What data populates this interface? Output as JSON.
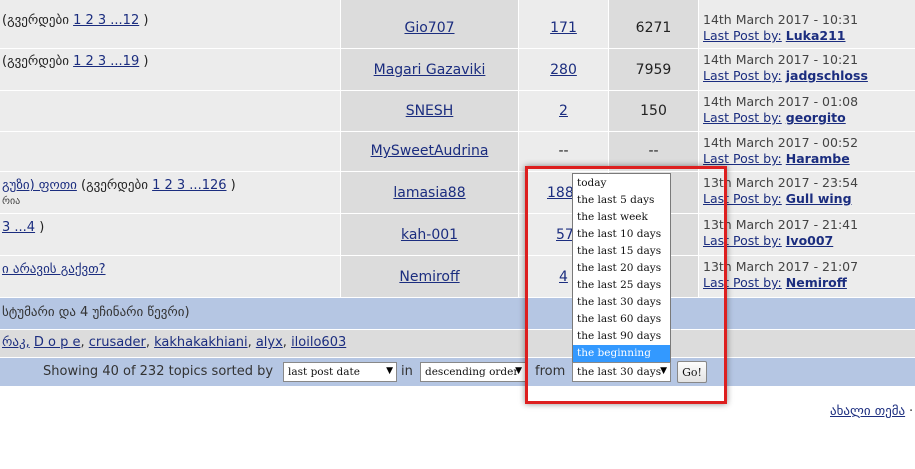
{
  "topics": [
    {
      "title_text": "(გვერდები",
      "pages": "1 2 3 ...12",
      "tail": ")",
      "subtitle": "",
      "author": "Gio707",
      "replies": "171",
      "views": "6271",
      "last_date": "14th March 2017 - 10:31",
      "last_by_label": "Last Post by:",
      "last_user": "Luka211"
    },
    {
      "title_text": "(გვერდები",
      "pages": "1 2 3 ...19",
      "tail": ")",
      "subtitle": "",
      "author": "Magari Gazaviki",
      "replies": "280",
      "views": "7959",
      "last_date": "14th March 2017 - 10:21",
      "last_by_label": "Last Post by:",
      "last_user": "jadgschloss"
    },
    {
      "title_text": "",
      "pages": "",
      "tail": "",
      "subtitle": "",
      "author": "SNESH",
      "replies": "2",
      "views": "150",
      "last_date": "14th March 2017 - 01:08",
      "last_by_label": "Last Post by:",
      "last_user": "georgito"
    },
    {
      "title_text": "",
      "pages": "",
      "tail": "",
      "subtitle": "",
      "author": "MySweetAudrina",
      "replies": "--",
      "views": "--",
      "last_date": "14th March 2017 - 00:52",
      "last_by_label": "Last Post by:",
      "last_user": "Harambe"
    },
    {
      "title_link": "გუზი) ფოთი",
      "title_text": "(გვერდები",
      "pages": "1 2 3 ...126",
      "tail": ")",
      "subtitle": "რია",
      "author": "lamasia88",
      "replies": "188",
      "views": "",
      "last_date": "13th March 2017 - 23:54",
      "last_by_label": "Last Post by:",
      "last_user": "Gull wing"
    },
    {
      "title_link": "3 ...4",
      "title_text": "",
      "pages": "",
      "tail": ")",
      "subtitle": "",
      "author": "kah-001",
      "replies": "57",
      "views": "",
      "last_date": "13th March 2017 - 21:41",
      "last_by_label": "Last Post by:",
      "last_user": "Ivo007"
    },
    {
      "title_link": "ი არავის გაქვთ?",
      "title_text": "",
      "pages": "",
      "tail": "",
      "subtitle": "",
      "author": "Nemiroff",
      "replies": "4",
      "views": "",
      "last_date": "13th March 2017 - 21:07",
      "last_by_label": "Last Post by:",
      "last_user": "Nemiroff"
    }
  ],
  "stats": {
    "guests_text": "სტუმარი და 4 უჩინარი წევრი)",
    "users_prefix": "რაკ,",
    "users": [
      "D o p e",
      "crusader",
      "kakhakakhiani",
      "alyx",
      "iloilo603"
    ]
  },
  "sort_bar": {
    "showing_text": "Showing 40 of 232 topics sorted by",
    "sort_by_value": "last post date",
    "in_label": "in",
    "order_value": "descending order",
    "from_label": "from",
    "from_value": "the last 30 days",
    "go_label": "Go!"
  },
  "dropdown": {
    "options": [
      "today",
      "the last 5 days",
      "the last week",
      "the last 10 days",
      "the last 15 days",
      "the last 20 days",
      "the last 25 days",
      "the last 30 days",
      "the last 60 days",
      "the last 90 days",
      "the beginning"
    ],
    "highlighted": "the beginning"
  },
  "footer": {
    "new_topic_link": "ახალი თემა",
    "dot": "·"
  },
  "colors": {
    "highlight_box": "#dd1f1f",
    "stats_bar": "#b5c6e3",
    "selected_option": "#3399ff",
    "link": "#1b2d7f"
  },
  "icons": {
    "select_arrow": "triangle-down-icon"
  }
}
